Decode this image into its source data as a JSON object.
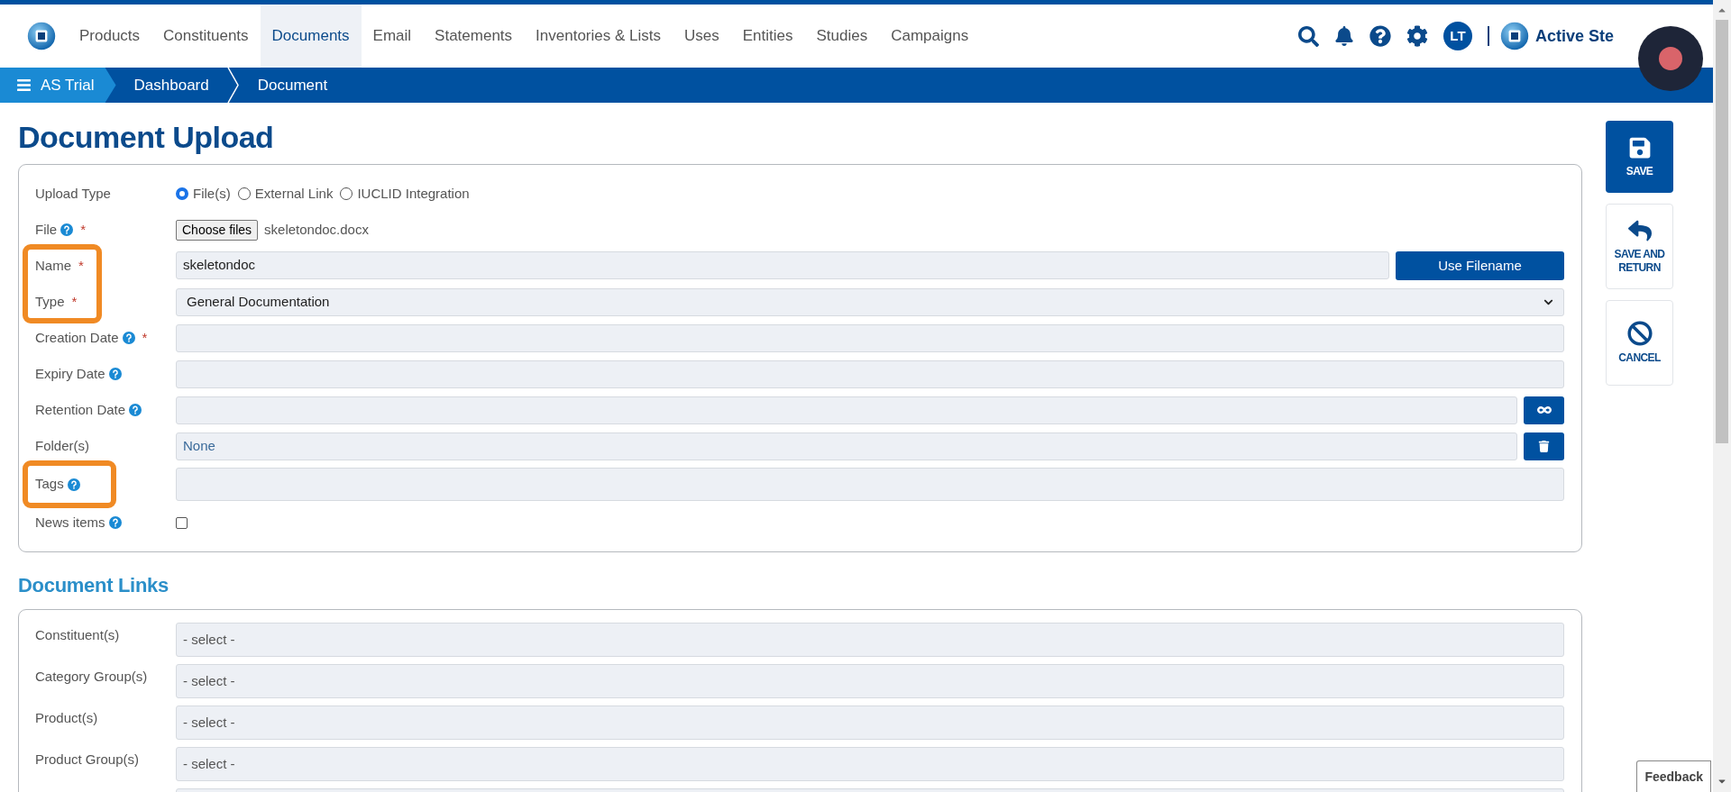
{
  "nav": {
    "items": [
      {
        "label": "Products",
        "selected": false
      },
      {
        "label": "Constituents",
        "selected": false
      },
      {
        "label": "Documents",
        "selected": true
      },
      {
        "label": "Email",
        "selected": false
      },
      {
        "label": "Statements",
        "selected": false
      },
      {
        "label": "Inventories & Lists",
        "selected": false
      },
      {
        "label": "Uses",
        "selected": false
      },
      {
        "label": "Entities",
        "selected": false
      },
      {
        "label": "Studies",
        "selected": false
      },
      {
        "label": "Campaigns",
        "selected": false
      }
    ],
    "user_initials": "LT",
    "brand": "Active Ste"
  },
  "breadcrumb": [
    {
      "label": "AS Trial",
      "kind": "menu"
    },
    {
      "label": "Dashboard",
      "kind": "crumb"
    },
    {
      "label": "Document",
      "kind": "crumb"
    }
  ],
  "page_title": "Document Upload",
  "upload_form": {
    "fields": [
      {
        "kind": "radio",
        "label": "Upload Type",
        "help": false,
        "highlighted": false,
        "options": [
          {
            "label": "File(s)",
            "selected": true
          },
          {
            "label": "External Link",
            "selected": false
          },
          {
            "label": "IUCLID Integration",
            "selected": false
          }
        ]
      },
      {
        "kind": "file",
        "label": "File",
        "help": true,
        "required_mark": "*",
        "highlighted": false,
        "button": "Choose files",
        "value": "skeletondoc.docx"
      },
      {
        "kind": "text",
        "label": "Name",
        "help": false,
        "required_mark": "*",
        "highlighted": true,
        "value": "skeletondoc",
        "button": "Use Filename"
      },
      {
        "kind": "select",
        "label": "Type",
        "help": false,
        "required_mark": "*",
        "highlighted": true,
        "value": "General Documentation"
      },
      {
        "kind": "text",
        "label": "Creation Date",
        "help": true,
        "required_mark": "*",
        "highlighted": false
      },
      {
        "kind": "text",
        "label": "Expiry Date",
        "help": true,
        "highlighted": false
      },
      {
        "kind": "text",
        "label": "Retention Date",
        "help": true,
        "highlighted": false,
        "action": {
          "kind": "infinity"
        }
      },
      {
        "kind": "text",
        "label": "Folder(s)",
        "help": false,
        "highlighted": false,
        "value": "None",
        "action": {
          "kind": "delete"
        }
      },
      {
        "kind": "tags",
        "label": "Tags",
        "help": true,
        "highlighted": true
      },
      {
        "kind": "checkbox",
        "label": "News items",
        "help": true,
        "highlighted": false,
        "checked": false
      }
    ]
  },
  "links_section": {
    "title": "Document Links",
    "fields": [
      {
        "label": "Constituent(s)",
        "value": "- select -"
      },
      {
        "label": "Category Group(s)",
        "value": "- select -"
      },
      {
        "label": "Product(s)",
        "value": "- select -"
      },
      {
        "label": "Product Group(s)",
        "value": "- select -"
      }
    ]
  },
  "actions": [
    {
      "label": "SAVE",
      "kind": "primary"
    },
    {
      "label": "SAVE AND RETURN",
      "kind": "return"
    },
    {
      "label": "CANCEL",
      "kind": "cancel"
    }
  ],
  "feedback": "Feedback"
}
